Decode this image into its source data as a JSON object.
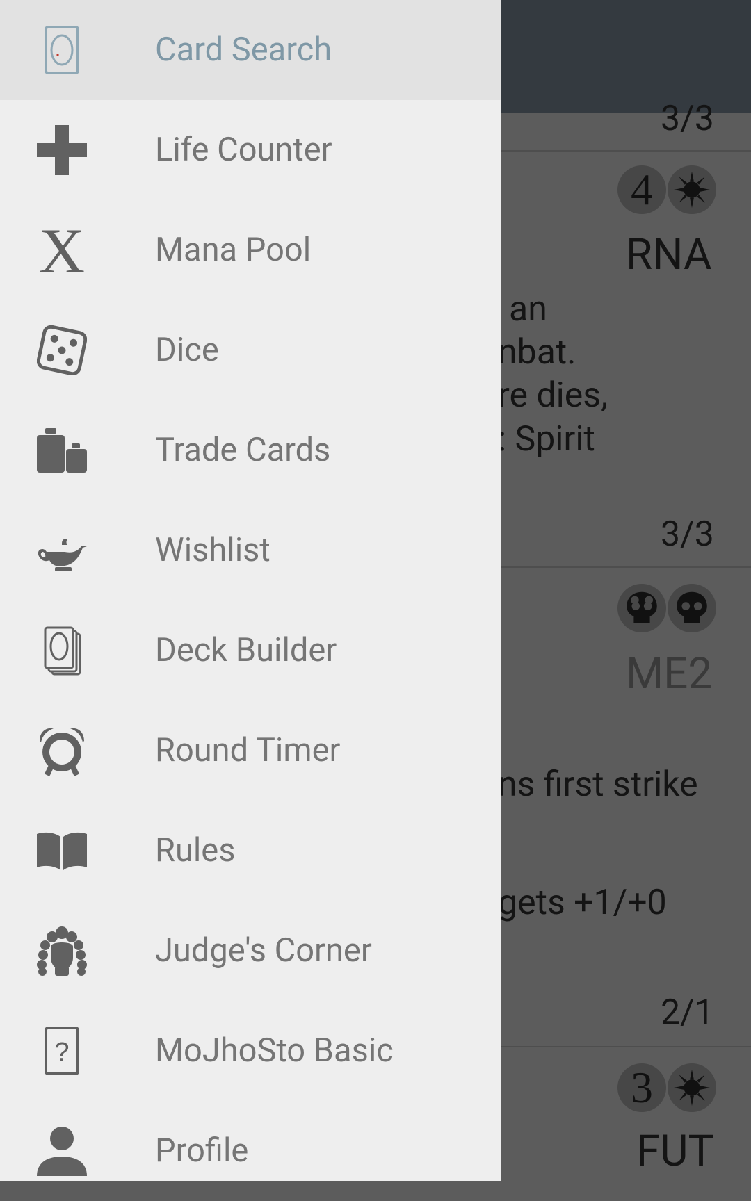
{
  "drawer": {
    "items": [
      {
        "label": "Card Search",
        "icon": "card-search-icon",
        "active": true
      },
      {
        "label": "Life Counter",
        "icon": "plus-icon"
      },
      {
        "label": "Mana Pool",
        "icon": "x-icon"
      },
      {
        "label": "Dice",
        "icon": "dice-icon"
      },
      {
        "label": "Trade Cards",
        "icon": "weights-icon"
      },
      {
        "label": "Wishlist",
        "icon": "genie-lamp-icon"
      },
      {
        "label": "Deck Builder",
        "icon": "card-stack-icon"
      },
      {
        "label": "Round Timer",
        "icon": "alarm-clock-icon"
      },
      {
        "label": "Rules",
        "icon": "book-icon"
      },
      {
        "label": "Judge's Corner",
        "icon": "judge-wig-icon"
      },
      {
        "label": "MoJhoSto Basic",
        "icon": "question-card-icon"
      },
      {
        "label": "Profile",
        "icon": "person-icon"
      }
    ]
  },
  "background_list": {
    "pt_1": "3/3",
    "cost_1": "4",
    "set_1": "RNA",
    "text_1": [
      "an",
      "nbat.",
      "re dies,",
      ": Spirit"
    ],
    "pt_2": "3/3",
    "set_2": "ME2",
    "text_2a": "ns first strike",
    "text_2b": "gets +1/+0",
    "pt_3": "2/1",
    "cost_3": "3",
    "set_3": "FUT"
  },
  "colors": {
    "drawer_bg": "#eeeeee",
    "active_item_bg": "#e2e2e2",
    "active_label": "#7f98a6",
    "label": "#757575",
    "icon": "#616161",
    "toolbar": "#343a40",
    "scrim": "#5c5c5c"
  }
}
